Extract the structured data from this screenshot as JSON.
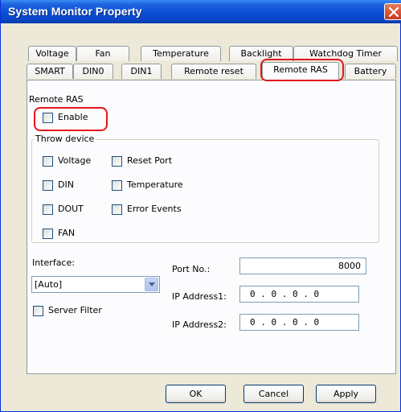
{
  "window": {
    "title": "System Monitor Property"
  },
  "tabs": {
    "row1": [
      "Voltage",
      "Fan",
      "Temperature",
      "Backlight",
      "Watchdog Timer"
    ],
    "row2": [
      "SMART",
      "DIN0",
      "DIN1",
      "Remote reset",
      "Remote RAS",
      "Battery"
    ],
    "active": "Remote RAS"
  },
  "remote_ras": {
    "group_label": "Remote RAS",
    "enable_label": "Enable",
    "enable_checked": false,
    "throw_device": {
      "label": "Throw device",
      "items": [
        "Voltage",
        "DIN",
        "DOUT",
        "FAN",
        "Reset Port",
        "Temperature",
        "Error Events"
      ]
    }
  },
  "interface": {
    "label": "Interface:",
    "selected": "[Auto]"
  },
  "server_filter_label": "Server Filter",
  "port": {
    "label": "Port No.:",
    "value": "8000"
  },
  "ip1": {
    "label": "IP Address1:",
    "value": "0 . 0 . 0 . 0"
  },
  "ip2": {
    "label": "IP Address2:",
    "value": "0 . 0 . 0 . 0"
  },
  "buttons": {
    "ok": "OK",
    "cancel": "Cancel",
    "apply": "Apply"
  },
  "colors": {
    "titlebar": "#0a4fd4",
    "dialog_bg": "#ece9d8",
    "highlight_outline": "#e5151b",
    "close_button": "#c8391c"
  }
}
